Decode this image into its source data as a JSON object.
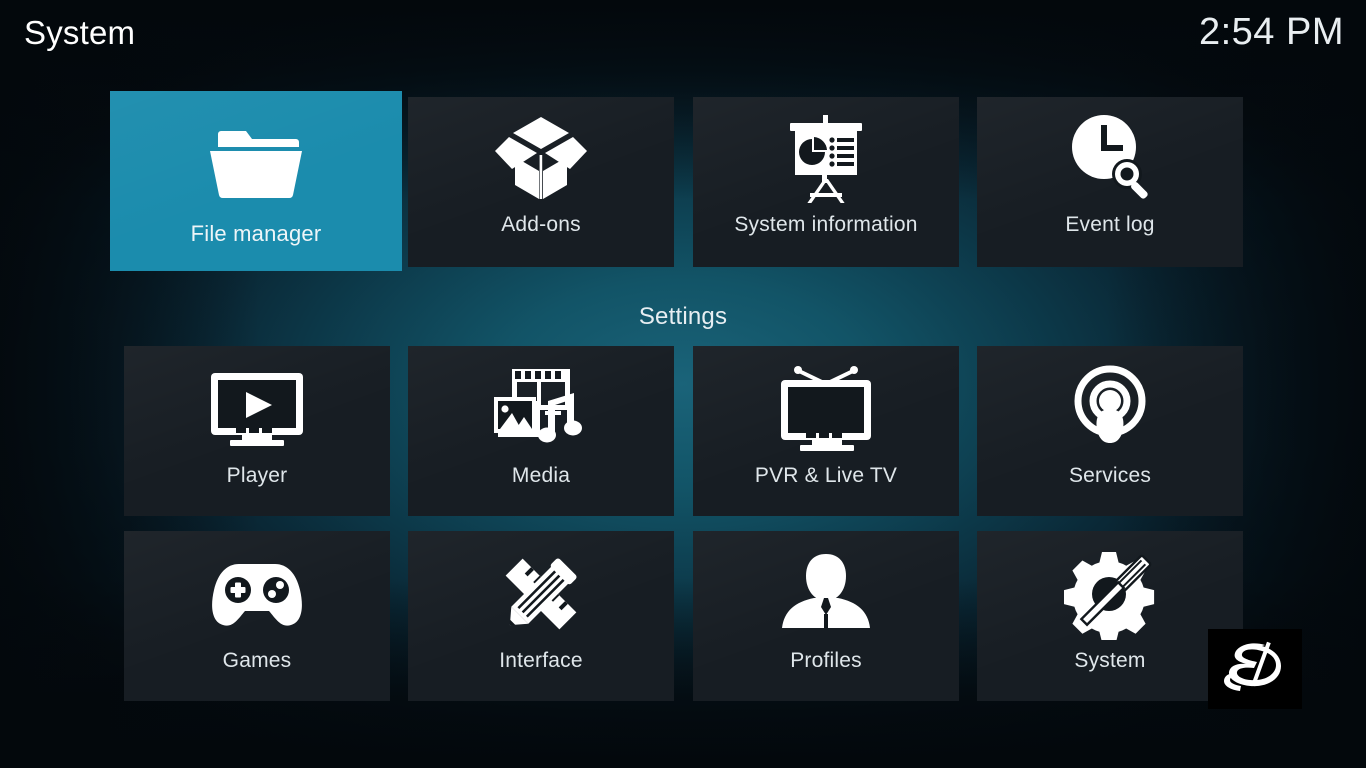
{
  "header": {
    "title": "System",
    "clock": "2:54 PM"
  },
  "colors": {
    "focus_accent": "#1b8cad",
    "tile_background": "#171d23",
    "background_center": "#1a6379",
    "background_edge": "#040d13",
    "label_text": "#dfe6ea"
  },
  "section_label": "Settings",
  "top_row": [
    {
      "label": "File manager",
      "icon": "folder-icon",
      "focused": true
    },
    {
      "label": "Add-ons",
      "icon": "open-box-icon",
      "focused": false
    },
    {
      "label": "System information",
      "icon": "presentation-board-icon",
      "focused": false
    },
    {
      "label": "Event log",
      "icon": "clock-search-icon",
      "focused": false
    }
  ],
  "settings_rows": [
    [
      {
        "label": "Player",
        "icon": "monitor-play-icon",
        "focused": false
      },
      {
        "label": "Media",
        "icon": "film-photo-music-icon",
        "focused": false
      },
      {
        "label": "PVR & Live TV",
        "icon": "tv-antenna-icon",
        "focused": false
      },
      {
        "label": "Services",
        "icon": "broadcast-person-icon",
        "focused": false
      }
    ],
    [
      {
        "label": "Games",
        "icon": "gamepad-icon",
        "focused": false
      },
      {
        "label": "Interface",
        "icon": "pencil-ruler-icon",
        "focused": false
      },
      {
        "label": "Profiles",
        "icon": "person-bust-icon",
        "focused": false
      },
      {
        "label": "System",
        "icon": "gear-screwdriver-icon",
        "focused": false
      }
    ]
  ],
  "overlay_logo": {
    "name": "sd-monogram-logo",
    "alt": "SD"
  }
}
